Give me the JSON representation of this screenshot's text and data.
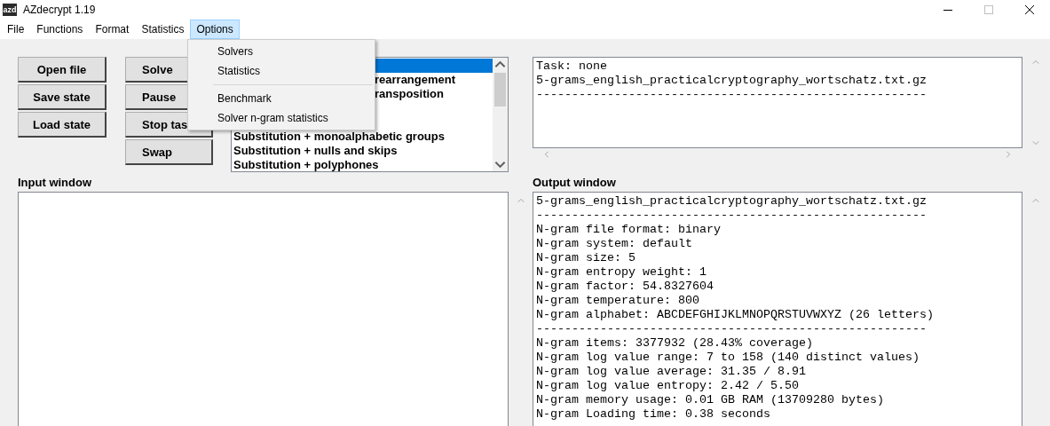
{
  "window": {
    "title": "AZdecrypt 1.19",
    "app_icon_text": "azd"
  },
  "menubar": [
    {
      "label": "File",
      "selected": false
    },
    {
      "label": "Functions",
      "selected": false
    },
    {
      "label": "Format",
      "selected": false
    },
    {
      "label": "Statistics",
      "selected": false
    },
    {
      "label": "Options",
      "selected": true
    }
  ],
  "dropdown": [
    {
      "kind": "item",
      "label": "Solvers"
    },
    {
      "kind": "item",
      "label": "Statistics"
    },
    {
      "kind": "separator"
    },
    {
      "kind": "item",
      "label": "Benchmark"
    },
    {
      "kind": "item",
      "label": "Solver n-gram statistics"
    }
  ],
  "buttons_left": [
    "Open file",
    "Save state",
    "Load state"
  ],
  "buttons_middle": [
    "Solve",
    "Pause",
    "Stop tas",
    "Swap"
  ],
  "solver_list": [
    {
      "kind": "covered",
      "selected": true
    },
    {
      "kind": "covered",
      "label": "rearrangement",
      "selected": false
    },
    {
      "kind": "covered",
      "label": "ransposition",
      "selected": false
    },
    {
      "kind": "covered",
      "selected": false
    },
    {
      "kind": "covered",
      "selected": false
    },
    {
      "kind": "full",
      "label": "Substitution + monoalphabetic groups",
      "selected": false
    },
    {
      "kind": "full",
      "label": "Substitution + nulls and skips",
      "selected": false
    },
    {
      "kind": "full",
      "label": "Substitution + polyphones",
      "selected": false
    }
  ],
  "task_box": [
    "Task: none",
    "5-grams_english_practicalcryptography_wortschatz.txt.gz",
    "-------------------------------------------------------"
  ],
  "input_label": "Input window",
  "output_label": "Output window",
  "output_box": [
    "5-grams_english_practicalcryptography_wortschatz.txt.gz",
    "-------------------------------------------------------",
    "N-gram file format: binary",
    "N-gram system: default",
    "N-gram size: 5",
    "N-gram entropy weight: 1",
    "N-gram factor: 54.8327604",
    "N-gram temperature: 800",
    "N-gram alphabet: ABCDEFGHIJKLMNOPQRSTUVWXYZ (26 letters)",
    "-------------------------------------------------------",
    "N-gram items: 3377932 (28.43% coverage)",
    "N-gram log value range: 7 to 158 (140 distinct values)",
    "N-gram log value average: 31.35 / 8.91",
    "N-gram log value entropy: 2.42 / 5.50",
    "N-gram memory usage: 0.01 GB RAM (13709280 bytes)",
    "N-gram Loading time: 0.38 seconds"
  ]
}
